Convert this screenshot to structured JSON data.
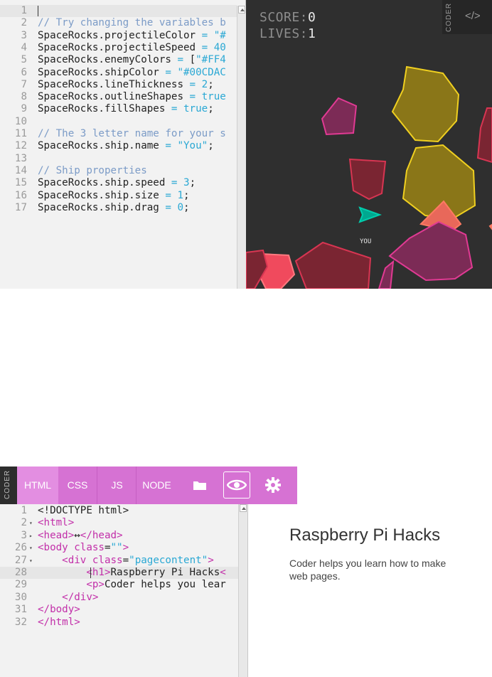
{
  "top_editor": {
    "lines": [
      {
        "n": "1",
        "t": ""
      },
      {
        "n": "2",
        "t": "// Try changing the variables b"
      },
      {
        "n": "3",
        "t": "SpaceRocks.projectileColor = \"#"
      },
      {
        "n": "4",
        "t": "SpaceRocks.projectileSpeed = 40"
      },
      {
        "n": "5",
        "t": "SpaceRocks.enemyColors = [\"#FF4"
      },
      {
        "n": "6",
        "t": "SpaceRocks.shipColor = \"#00CDAC"
      },
      {
        "n": "7",
        "t": "SpaceRocks.lineThickness = 2;"
      },
      {
        "n": "8",
        "t": "SpaceRocks.outlineShapes = true"
      },
      {
        "n": "9",
        "t": "SpaceRocks.fillShapes = true;"
      },
      {
        "n": "10",
        "t": ""
      },
      {
        "n": "11",
        "t": "// The 3 letter name for your s"
      },
      {
        "n": "12",
        "t": "SpaceRocks.ship.name = \"You\";"
      },
      {
        "n": "13",
        "t": ""
      },
      {
        "n": "14",
        "t": "// Ship properties"
      },
      {
        "n": "15",
        "t": "SpaceRocks.ship.speed = 3;"
      },
      {
        "n": "16",
        "t": "SpaceRocks.ship.size = 1;"
      },
      {
        "n": "17",
        "t": "SpaceRocks.ship.drag = 0;"
      }
    ]
  },
  "game": {
    "score_label": "SCORE:",
    "score_value": "0",
    "lives_label": "LIVES:",
    "lives_value": "1",
    "ship_name": "YOU",
    "side_logo": "CODER",
    "code_toggle": "</>",
    "ship_color": "#00CDAC"
  },
  "bottom_toolbar": {
    "logo": "CODER",
    "tabs": [
      "HTML",
      "CSS",
      "JS",
      "NODE"
    ],
    "active_tab": "HTML",
    "icons": [
      "folder-icon",
      "eye-icon",
      "gear-icon"
    ],
    "accent": "#D672D3"
  },
  "bottom_editor": {
    "lines": [
      {
        "n": "1",
        "fold": "",
        "html": [
          [
            "t-plain",
            "<!DOCTYPE html>"
          ]
        ]
      },
      {
        "n": "2",
        "fold": "▾",
        "html": [
          [
            "t-tag",
            "<html>"
          ]
        ]
      },
      {
        "n": "3",
        "fold": "▸",
        "html": [
          [
            "t-tag",
            "<head>"
          ],
          [
            "t-plain",
            "↔"
          ],
          [
            "t-tag",
            "</head>"
          ]
        ]
      },
      {
        "n": "26",
        "fold": "▾",
        "html": [
          [
            "t-tag",
            "<body "
          ],
          [
            "t-attr",
            "class"
          ],
          [
            "t-plain",
            "="
          ],
          [
            "t-val",
            "\"\""
          ],
          [
            "t-tag",
            ">"
          ]
        ]
      },
      {
        "n": "27",
        "fold": "▾",
        "html": [
          [
            "t-plain",
            "    "
          ],
          [
            "t-tag",
            "<div "
          ],
          [
            "t-attr",
            "class"
          ],
          [
            "t-plain",
            "="
          ],
          [
            "t-val",
            "\"pagecontent\""
          ],
          [
            "t-tag",
            ">"
          ]
        ]
      },
      {
        "n": "28",
        "fold": "",
        "html": [
          [
            "t-plain",
            "        "
          ],
          [
            "t-tag",
            "<h1>"
          ],
          [
            "t-plain",
            "Raspberry Pi Hacks"
          ],
          [
            "t-tag",
            "<"
          ]
        ]
      },
      {
        "n": "29",
        "fold": "",
        "html": [
          [
            "t-plain",
            "        "
          ],
          [
            "t-tag",
            "<p>"
          ],
          [
            "t-plain",
            "Coder helps you lear"
          ]
        ]
      },
      {
        "n": "30",
        "fold": "",
        "html": [
          [
            "t-plain",
            "    "
          ],
          [
            "t-tag",
            "</div>"
          ]
        ]
      },
      {
        "n": "31",
        "fold": "",
        "html": [
          [
            "t-tag",
            "</body>"
          ]
        ]
      },
      {
        "n": "32",
        "fold": "",
        "html": [
          [
            "t-tag",
            "</html>"
          ]
        ]
      }
    ],
    "active_line": "28"
  },
  "preview": {
    "title": "Raspberry Pi Hacks",
    "text": "Coder helps you learn how to make web pages."
  }
}
